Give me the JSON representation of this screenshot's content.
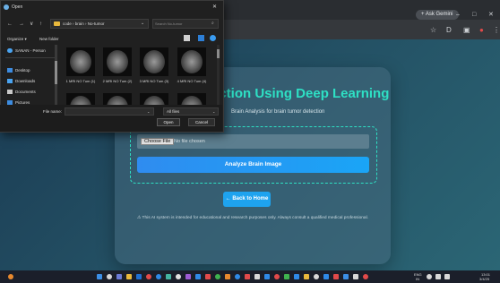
{
  "browser": {
    "ask_gemini": "+ Ask Gemini",
    "window_controls": [
      "–",
      "□",
      "✕"
    ],
    "toolbar_icons": [
      "☆",
      "D",
      "▣",
      "●",
      "⋮"
    ]
  },
  "page": {
    "title": "ection Using Deep Learning",
    "subtitle": "Brain Analysis for brain tumor detection",
    "upload": {
      "choose_file": "Choose File",
      "no_file": "No file chosen"
    },
    "analyze_button": "Analyze Brain Image",
    "back_button": "← Back to Home",
    "disclaimer": "⚠ This AI system is intended for educational and research purposes only. Always consult a qualified medical professional."
  },
  "file_dialog": {
    "title": "Open",
    "close": "✕",
    "nav": [
      "←",
      "→",
      "∨",
      "↑"
    ],
    "path": "code › brain › No-tumor",
    "search_placeholder": "Search No-tumor",
    "search_icon": "⌕",
    "toolbar": {
      "organize": "Organize ▾",
      "new_folder": "New folder"
    },
    "sidebar": [
      {
        "label": "SANAN - Person",
        "icon": "cloud-icon",
        "color": "#4aa3f0"
      },
      {
        "label": "Desktop",
        "icon": "desktop-icon",
        "color": "#3d8ce0"
      },
      {
        "label": "Downloads",
        "icon": "download-icon",
        "color": "#4aa3f0"
      },
      {
        "label": "Documents",
        "icon": "document-icon",
        "color": "#c9c9c9"
      },
      {
        "label": "Pictures",
        "icon": "pictures-icon",
        "color": "#3d8ce0"
      }
    ],
    "files": [
      {
        "name": "1 MRI NO Tum (1)"
      },
      {
        "name": "2 MRI NO Tum (2)"
      },
      {
        "name": "3 MRI NO Tum (3)"
      },
      {
        "name": "4 MRI NO Tum (4)"
      }
    ],
    "file_name_label": "File name:",
    "filter": "All files",
    "open_button": "Open",
    "cancel_button": "Cancel"
  },
  "taskbar": {
    "tray_lang": "ENG",
    "tray_region": "IN",
    "time": "13:01",
    "date": "3/4/25"
  }
}
